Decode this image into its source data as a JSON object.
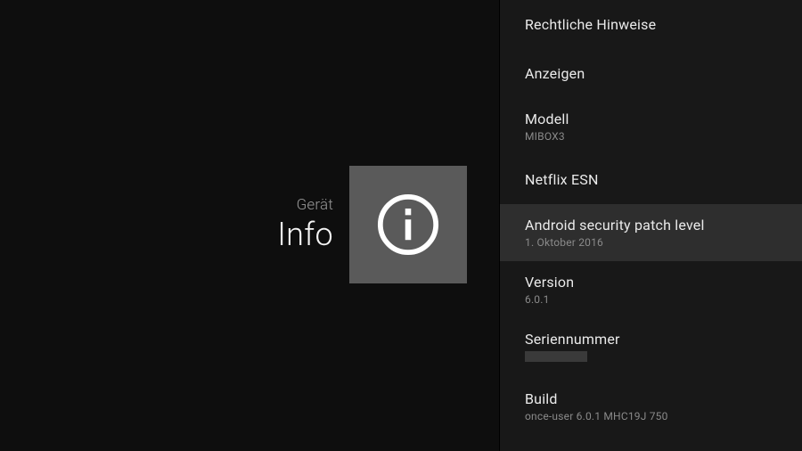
{
  "left": {
    "category": "Gerät",
    "title": "Info"
  },
  "list": {
    "items": [
      {
        "title": "Rechtliche Hinweise",
        "sub": null,
        "selected": false
      },
      {
        "title": "Anzeigen",
        "sub": null,
        "selected": false
      },
      {
        "title": "Modell",
        "sub": "MIBOX3",
        "selected": false
      },
      {
        "title": "Netflix ESN",
        "sub": null,
        "selected": false
      },
      {
        "title": "Android security patch level",
        "sub": "1. Oktober 2016",
        "selected": true
      },
      {
        "title": "Version",
        "sub": "6.0.1",
        "selected": false
      },
      {
        "title": "Seriennummer",
        "sub": "",
        "redacted": true,
        "selected": false
      },
      {
        "title": "Build",
        "sub": "once-user 6.0.1 MHC19J 750",
        "selected": false
      }
    ]
  }
}
